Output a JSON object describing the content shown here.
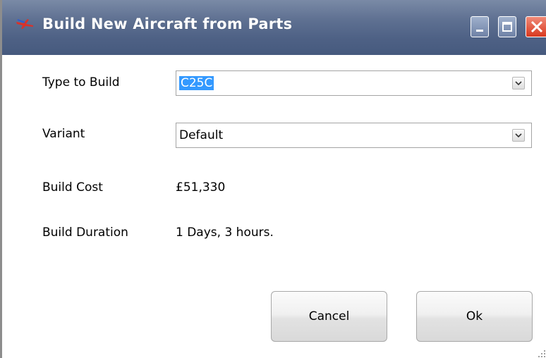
{
  "window": {
    "title": "Build New Aircraft from Parts",
    "app_icon": "aircraft-icon",
    "controls": [
      "minimize-icon",
      "maximize-icon",
      "close-icon"
    ]
  },
  "form": {
    "type_label": "Type to Build",
    "type_value": "C25C",
    "variant_label": "Variant",
    "variant_value": "Default",
    "cost_label": "Build Cost",
    "cost_value": "£51,330",
    "duration_label": "Build Duration",
    "duration_value": "1 Days, 3 hours."
  },
  "buttons": {
    "cancel_label": "Cancel",
    "ok_label": "Ok"
  },
  "colors": {
    "titlebar": "#55688b",
    "selection": "#3399ff",
    "close_button": "#e04a30"
  }
}
